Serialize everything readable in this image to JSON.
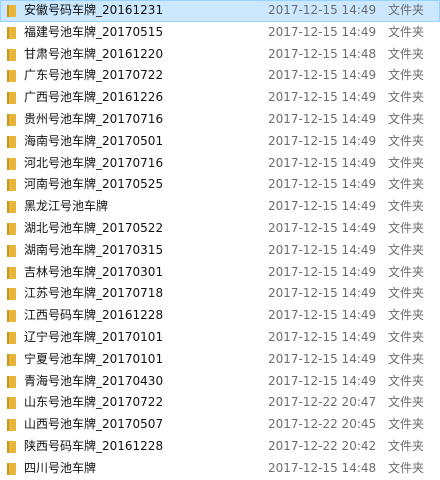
{
  "files": [
    {
      "name": "安徽号码车牌_20161231",
      "modified": "2017-12-15 14:49",
      "type": "文件夹",
      "selected": true
    },
    {
      "name": "福建号池车牌_20170515",
      "modified": "2017-12-15 14:49",
      "type": "文件夹"
    },
    {
      "name": "甘肃号池车牌_20161220",
      "modified": "2017-12-15 14:48",
      "type": "文件夹"
    },
    {
      "name": "广东号池车牌_20170722",
      "modified": "2017-12-15 14:49",
      "type": "文件夹"
    },
    {
      "name": "广西号池车牌_20161226",
      "modified": "2017-12-15 14:49",
      "type": "文件夹"
    },
    {
      "name": "贵州号池车牌_20170716",
      "modified": "2017-12-15 14:49",
      "type": "文件夹"
    },
    {
      "name": "海南号池车牌_20170501",
      "modified": "2017-12-15 14:49",
      "type": "文件夹"
    },
    {
      "name": "河北号池车牌_20170716",
      "modified": "2017-12-15 14:49",
      "type": "文件夹"
    },
    {
      "name": "河南号池车牌_20170525",
      "modified": "2017-12-15 14:49",
      "type": "文件夹"
    },
    {
      "name": "黑龙江号池车牌",
      "modified": "2017-12-15 14:49",
      "type": "文件夹"
    },
    {
      "name": "湖北号池车牌_20170522",
      "modified": "2017-12-15 14:49",
      "type": "文件夹"
    },
    {
      "name": "湖南号池车牌_20170315",
      "modified": "2017-12-15 14:49",
      "type": "文件夹"
    },
    {
      "name": "吉林号池车牌_20170301",
      "modified": "2017-12-15 14:49",
      "type": "文件夹"
    },
    {
      "name": "江苏号池车牌_20170718",
      "modified": "2017-12-15 14:49",
      "type": "文件夹"
    },
    {
      "name": "江西号码车牌_20161228",
      "modified": "2017-12-15 14:49",
      "type": "文件夹"
    },
    {
      "name": "辽宁号池车牌_20170101",
      "modified": "2017-12-15 14:49",
      "type": "文件夹"
    },
    {
      "name": "宁夏号池车牌_20170101",
      "modified": "2017-12-15 14:49",
      "type": "文件夹"
    },
    {
      "name": "青海号池车牌_20170430",
      "modified": "2017-12-15 14:49",
      "type": "文件夹"
    },
    {
      "name": "山东号池车牌_20170722",
      "modified": "2017-12-22 20:47",
      "type": "文件夹"
    },
    {
      "name": "山西号池车牌_20170507",
      "modified": "2017-12-22 20:45",
      "type": "文件夹"
    },
    {
      "name": "陕西号码车牌_20161228",
      "modified": "2017-12-22 20:42",
      "type": "文件夹"
    },
    {
      "name": "四川号池车牌",
      "modified": "2017-12-15 14:48",
      "type": "文件夹"
    }
  ],
  "colors": {
    "folder_yellow": "#e8b53b",
    "folder_dark": "#c9951f",
    "selected_bg": "#cce8ff"
  },
  "icons": {
    "folder": "folder-icon"
  }
}
